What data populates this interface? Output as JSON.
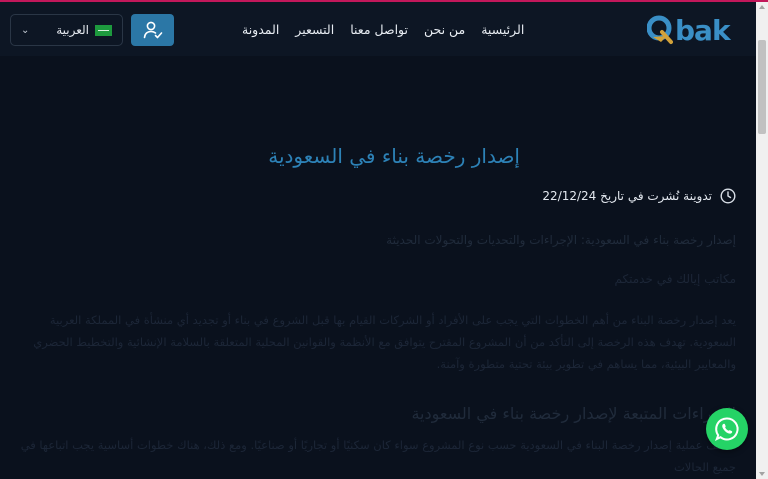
{
  "header": {
    "logo_text": "bak",
    "nav": [
      {
        "label": "الرئيسية"
      },
      {
        "label": "من نحن"
      },
      {
        "label": "تواصل معنا"
      },
      {
        "label": "التسعير"
      },
      {
        "label": "المدونة"
      }
    ],
    "language": {
      "selected": "العربية"
    }
  },
  "article": {
    "title": "إصدار رخصة بناء في السعودية",
    "meta": "تدوينة نُشرت في تاريخ 22/12/24",
    "subtitle": "إصدار رخصة بناء في السعودية: الإجراءات والتحديات والتحولات الحديثة",
    "intro": "مكاتب إيالك في خدمتكم",
    "paragraph": "يعد إصدار رخصة البناء من أهم الخطوات التي يجب على الأفراد أو الشركات القيام بها قبل الشروع في بناء أو تجديد أي منشأة في المملكة العربية السعودية. تهدف هذه الرخصة إلى التأكد من أن المشروع المقترح يتوافق مع الأنظمة والقوانين المحلية المتعلقة بالسلامة الإنشائية والتخطيط الحضري والمعايير البيئية، مما يساهم في تطوير بيئة تحتية متطورة وآمنة.",
    "heading2": "الإجراءات المتبعة لإصدار رخصة بناء في السعودية",
    "paragraph2": "تختلف عملية إصدار رخصة البناء في السعودية حسب نوع المشروع سواء كان سكنيًا أو تجاريًا أو صناعيًا. ومع ذلك، هناك خطوات أساسية يجب اتباعها في جميع الحالات"
  },
  "colors": {
    "accent": "#2d82b7",
    "whatsapp": "#25d366",
    "background": "#0a111d"
  }
}
